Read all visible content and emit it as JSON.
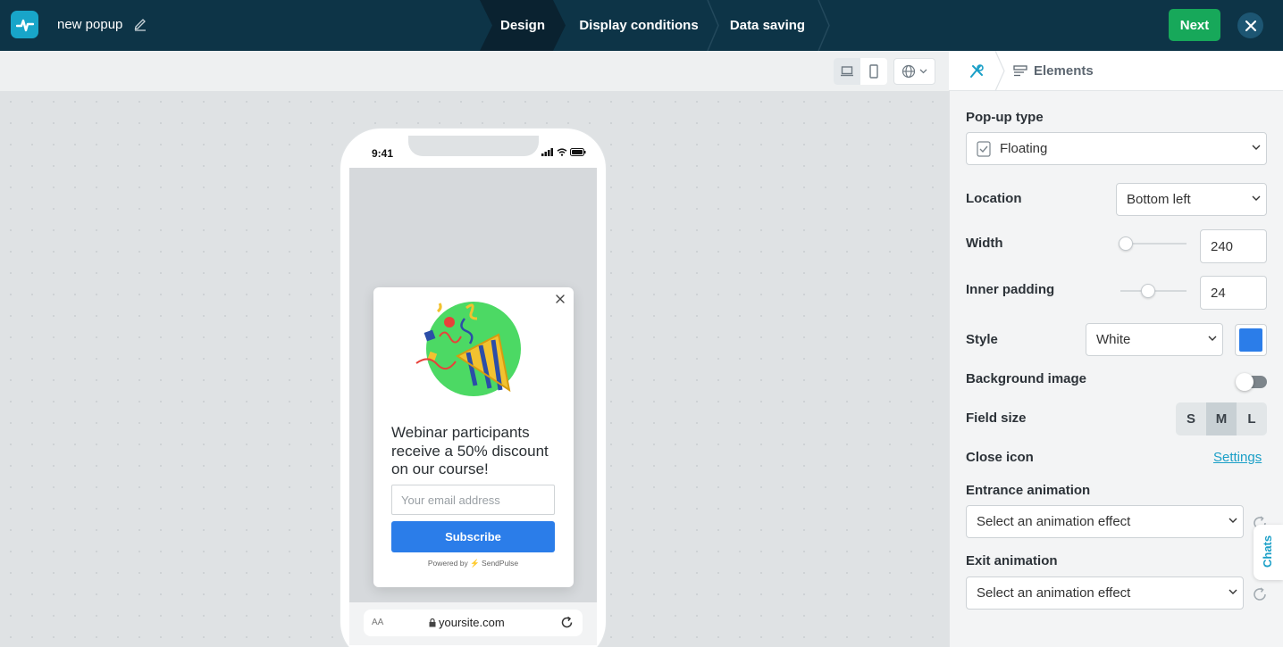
{
  "header": {
    "title": "new popup",
    "steps": [
      "Design",
      "Display conditions",
      "Data saving"
    ],
    "next_label": "Next"
  },
  "phone": {
    "time": "9:41",
    "url_aa": "AA",
    "url": "yoursite.com"
  },
  "popup": {
    "headline": "Webinar participants receive a 50% discount on our course!",
    "email_placeholder": "Your email address",
    "subscribe_label": "Subscribe",
    "powered_by": "Powered by",
    "brand": "SendPulse"
  },
  "panel": {
    "tab_label": "Elements",
    "popup_type_label": "Pop-up type",
    "popup_type_value": "Floating",
    "location_label": "Location",
    "location_value": "Bottom left",
    "width_label": "Width",
    "width_value": "240",
    "width_fraction": 0.0,
    "padding_label": "Inner padding",
    "padding_value": "24",
    "padding_fraction": 0.4,
    "style_label": "Style",
    "style_value": "White",
    "style_color": "#2b7de9",
    "bg_image_label": "Background image",
    "bg_image_on": false,
    "field_size_label": "Field size",
    "field_sizes": [
      "S",
      "M",
      "L"
    ],
    "field_size_selected": "M",
    "close_icon_label": "Close icon",
    "settings_link": "Settings",
    "entrance_label": "Entrance animation",
    "entrance_value": "Select an animation effect",
    "exit_label": "Exit animation",
    "exit_value": "Select an animation effect"
  },
  "chats_label": "Chats",
  "colors": {
    "topbar": "#0d3447",
    "accent_green": "#17a85a",
    "primary_blue": "#2b7de9",
    "link": "#1a9fc7"
  }
}
